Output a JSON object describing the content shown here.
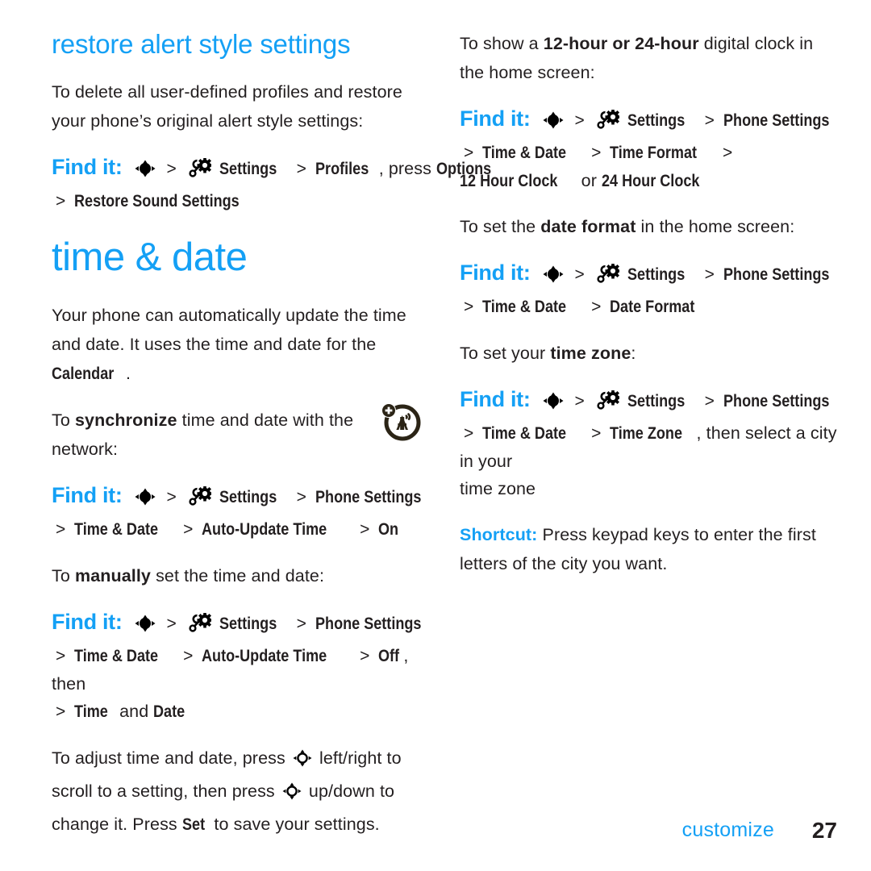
{
  "document": {
    "type": "phone-user-guide-page",
    "accent_color": "#14a0f5",
    "text_color": "#231f20",
    "background_color": "#ffffff"
  },
  "left_column": {
    "section_heading": "restore alert style settings",
    "intro_paragraph_line1": "To delete all user-defined profiles and restore",
    "intro_paragraph_line2": "your phone’s original alert style settings:",
    "findit_1": {
      "label": "Find it:",
      "nav_icon": "nav-key-icon",
      "gear_icon": "settings-wrench-gear-icon",
      "step_settings": "Settings",
      "step_profiles": "Profiles",
      "press_text": ", press ",
      "step_options": "Options",
      "step_restore": "Restore Sound Settings",
      "separator": ">"
    },
    "chapter_heading": "time & date",
    "para_1": {
      "line1": "Your phone can automatically update the time",
      "line2": "and date. It uses the time and date for the",
      "menu_word": "Calendar",
      "period": "."
    },
    "para_2": {
      "before": "To ",
      "bold": "synchronize",
      "after_line1": " time and date with the",
      "line2": "network:"
    },
    "note_icon": "network-tower-plus-icon",
    "findit_2": {
      "label": "Find it:",
      "step_settings": "Settings",
      "step_phone_settings": "Phone Settings",
      "step_time_date": "Time & Date",
      "step_auto_update": "Auto-Update Time",
      "step_on": "On",
      "separator": ">"
    },
    "para_3": {
      "before": "To ",
      "bold": "manually",
      "after": " set the time and date:"
    },
    "findit_3": {
      "label": "Find it:",
      "step_settings": "Settings",
      "step_phone_settings": "Phone Settings",
      "step_time_date": "Time & Date",
      "step_auto_update": "Auto-Update Time",
      "step_off": "Off",
      "then_text": ", then",
      "step_time": "Time",
      "and_text": " and ",
      "step_date": "Date",
      "separator": ">"
    },
    "para_4": {
      "seg1": "To adjust time and date, press ",
      "seg2": " left/right to scroll to a setting, then press ",
      "seg3": " up/down to change it. Press ",
      "bold_set": "Set",
      "seg4": " to save your settings.",
      "nav_icon": "nav-key-outline-icon"
    }
  },
  "right_column": {
    "para_1": {
      "before": "To show a ",
      "bold": "12-hour or 24-hour",
      "after_line1": " digital clock in",
      "line2": "the home screen:"
    },
    "findit_1": {
      "label": "Find it:",
      "step_settings": "Settings",
      "step_phone_settings": "Phone Settings",
      "step_time_date": "Time & Date",
      "step_time_format": "Time Format",
      "step_12hr": "12 Hour Clock",
      "or_text": " or ",
      "step_24hr": "24 Hour Clock",
      "separator": ">"
    },
    "para_2": {
      "before": "To set the ",
      "bold": "date format",
      "after": " in the home screen:"
    },
    "findit_2": {
      "label": "Find it:",
      "step_settings": "Settings",
      "step_phone_settings": "Phone Settings",
      "step_time_date": "Time & Date",
      "step_date_format": "Date Format",
      "separator": ">"
    },
    "para_3": {
      "before": "To set your ",
      "bold": "time zone",
      "after": ":"
    },
    "findit_3": {
      "label": "Find it:",
      "step_settings": "Settings",
      "step_phone_settings": "Phone Settings",
      "step_time_date": "Time & Date",
      "step_time_zone": "Time Zone",
      "then_text": ", then select a city in your",
      "line2": "time zone",
      "separator": ">"
    },
    "shortcut": {
      "label": "Shortcut:",
      "text_line1": " Press keypad keys to enter the first",
      "text_line2": "letters of the city you want."
    }
  },
  "footer": {
    "chapter_name": "customize",
    "page_number": "27"
  }
}
